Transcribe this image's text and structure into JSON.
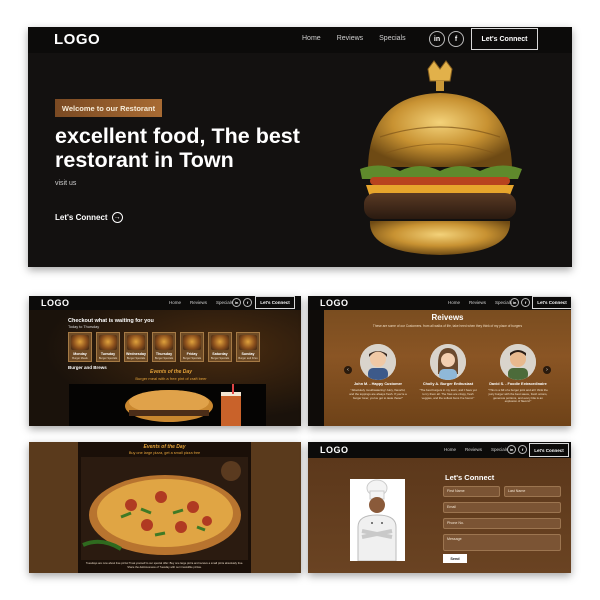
{
  "hero": {
    "logo": "LOGO",
    "nav": [
      "Home",
      "Reviews",
      "Specials"
    ],
    "social": [
      "in",
      "f"
    ],
    "connect_button": "Let's Connect",
    "badge": "Welcome to our Restorant",
    "title": "excellent food, The best restorant in Town",
    "subtitle": "visit us",
    "cta": "Let's Connect",
    "cta_arrow": "→"
  },
  "menu": {
    "logo": "LOGO",
    "nav": [
      "Home",
      "Reviews",
      "Specials"
    ],
    "social": [
      "in",
      "f"
    ],
    "connect_button": "Let's Connect",
    "heading": "Checkout what is waiting for you",
    "days_range": "Today to Thursday",
    "cards": [
      {
        "day": "Monday",
        "desc": "Burger Meals"
      },
      {
        "day": "Tuesday",
        "desc": "Burger Specials"
      },
      {
        "day": "Wednesday",
        "desc": "Burger Specials"
      },
      {
        "day": "Thursday",
        "desc": "Burger Specials"
      },
      {
        "day": "Friday",
        "desc": "Burger Specials"
      },
      {
        "day": "Saturday",
        "desc": "Burger Specials"
      },
      {
        "day": "Sunday",
        "desc": "Burger and Fries"
      }
    ],
    "category": "Burger and Brews",
    "event_title": "Events of the Day",
    "event_sub": "Burger meal with a free pint of craft beer"
  },
  "reviews": {
    "logo": "LOGO",
    "nav": [
      "Home",
      "Reviews",
      "Specials"
    ],
    "social": [
      "in",
      "f"
    ],
    "connect_button": "Let's Connect",
    "title": "Reivews",
    "description": "These are some of our Customers. from all walks of life, take heed when they think of my place of burgers",
    "prev": "‹",
    "next": "›",
    "items": [
      {
        "name": "John M. - Happy Customer",
        "text": "\"Absolutely mouthwatering! Juicy, flavorful, and the toppings are always fresh. If you're a burger lover, you've got to taste these!\""
      },
      {
        "name": "Cholly A. Burger Enthusiast",
        "text": "\"The best burgers in my town, and I have yet to try them all. The fries are crispy, fresh veggies, and the softest buns I've found.\""
      },
      {
        "name": "David S. - Foodie Extraordinaire",
        "text": "\"This is a bill of a burger joint and all I think the juicy burger with the best sauce, fresh onions, generous portions, and every bite is an explosion of flavors!\""
      }
    ]
  },
  "pizza": {
    "event_title": "Events of the Day",
    "event_sub": "Buy one large pizza, get a small pizza free",
    "caption": "Tuesdays are now about free pizza! Treat yourself to our special offer: Buy one large pizza and receive a small pizza absolutely free. Share the deliciousness of Tuesday with our irresistible pizzas."
  },
  "contact": {
    "logo": "LOGO",
    "nav": [
      "Home",
      "Reviews",
      "Specials"
    ],
    "social": [
      "in",
      "f"
    ],
    "connect_button": "Let's Connect",
    "title": "Let's Connect",
    "fields": {
      "first_name": "First Name",
      "last_name": "Last Name",
      "email": "Email",
      "phone": "Phone No.",
      "message": "Message"
    },
    "send": "Send"
  },
  "colors": {
    "accent": "#a86b33",
    "event_gold": "#e6a43a",
    "dark_bg": "#131110",
    "brown_bg": "#6a4222"
  }
}
